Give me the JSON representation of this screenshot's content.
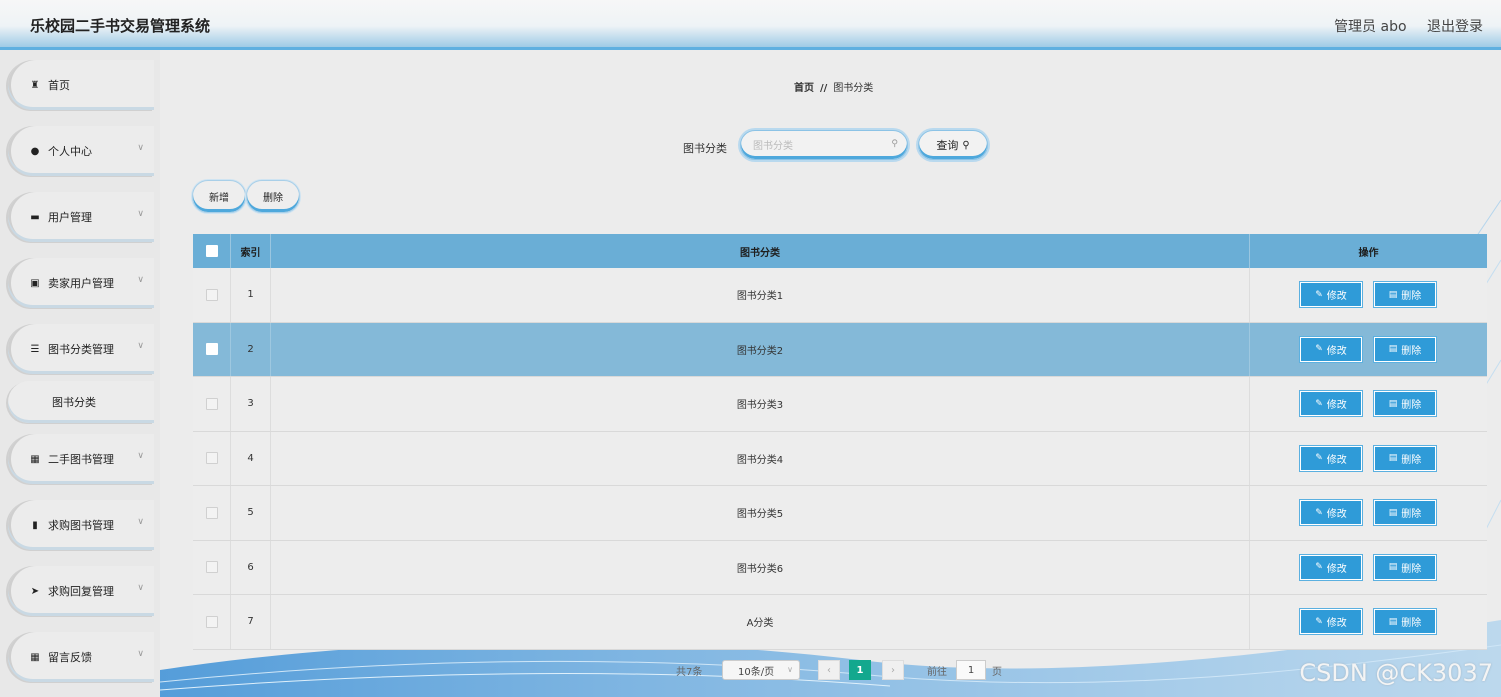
{
  "header": {
    "title": "乐校园二手书交易管理系统",
    "user_label": "管理员 abo",
    "logout_label": "退出登录"
  },
  "sidebar": {
    "items": [
      {
        "label": "首页",
        "icon": "home-icon",
        "has_children": false
      },
      {
        "label": "个人中心",
        "icon": "user-icon",
        "has_children": true
      },
      {
        "label": "用户管理",
        "icon": "monitor-icon",
        "has_children": true
      },
      {
        "label": "卖家用户管理",
        "icon": "chart-icon",
        "has_children": true
      },
      {
        "label": "图书分类管理",
        "icon": "list-icon",
        "has_children": true
      },
      {
        "label": "图书分类",
        "icon": "",
        "has_children": false,
        "sub": true
      },
      {
        "label": "二手图书管理",
        "icon": "grid-icon",
        "has_children": true
      },
      {
        "label": "求购图书管理",
        "icon": "bookmark-icon",
        "has_children": true
      },
      {
        "label": "求购回复管理",
        "icon": "send-icon",
        "has_children": true
      },
      {
        "label": "留言反馈",
        "icon": "grid-icon",
        "has_children": true
      }
    ]
  },
  "breadcrumb": {
    "home": "首页",
    "separator": "//",
    "current": "图书分类"
  },
  "search": {
    "label": "图书分类",
    "placeholder": "图书分类",
    "value": "",
    "button_label": "查询"
  },
  "actions": {
    "add_label": "新增",
    "delete_label": "删除"
  },
  "table": {
    "columns": [
      "索引",
      "图书分类",
      "操作"
    ],
    "edit_label": "修改",
    "delete_label": "删除",
    "rows": [
      {
        "index": "1",
        "name": "图书分类1"
      },
      {
        "index": "2",
        "name": "图书分类2"
      },
      {
        "index": "3",
        "name": "图书分类3"
      },
      {
        "index": "4",
        "name": "图书分类4"
      },
      {
        "index": "5",
        "name": "图书分类5"
      },
      {
        "index": "6",
        "name": "图书分类6"
      },
      {
        "index": "7",
        "name": "A分类"
      }
    ],
    "highlighted_row": 2
  },
  "pagination": {
    "total_label": "共7条",
    "page_size": "10条/页",
    "current_page": "1",
    "goto_label": "前往",
    "goto_value": "1",
    "page_suffix": "页"
  },
  "watermark": "CSDN @CK3037",
  "colors": {
    "accent": "#2f9bd8",
    "header_bar": "#6aaed6",
    "highlight_row": "#84b9d8",
    "page_current": "#13a88e"
  }
}
